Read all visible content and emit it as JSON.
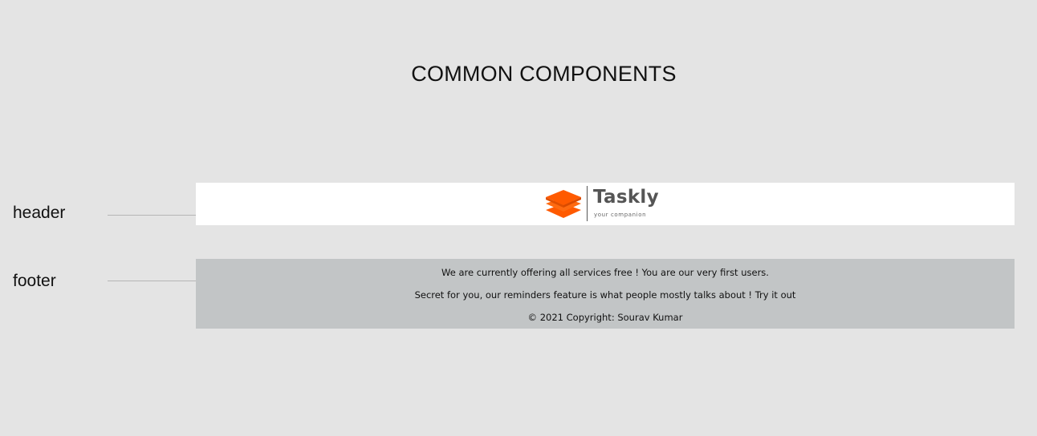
{
  "page": {
    "title": "COMMON COMPONENTS"
  },
  "labels": {
    "header": "header",
    "footer": "footer"
  },
  "header_preview": {
    "logo": {
      "name": "Taskly",
      "tagline": "your companion",
      "icon": "stacked-layers-icon",
      "accent_color": "#ff5a00"
    }
  },
  "footer_preview": {
    "lines": [
      "We are currently offering all services free ! You are our very first users.",
      "Secret for you, our reminders feature is what people mostly talks about ! Try it out",
      "© 2021 Copyright: Sourav Kumar"
    ],
    "background_color": "#c2c5c6"
  },
  "colors": {
    "page_background": "#e4e4e4",
    "header_background": "#ffffff"
  }
}
